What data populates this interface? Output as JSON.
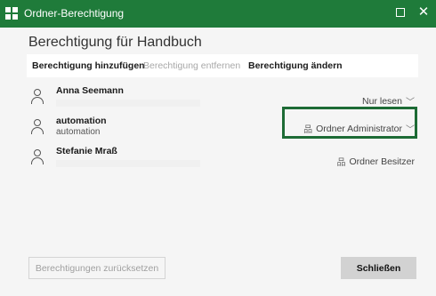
{
  "window": {
    "title": "Ordner-Berechtigung",
    "maximize_icon": "maximize-icon",
    "close_symbol": "✕"
  },
  "page_title": "Berechtigung für Handbuch",
  "actions": [
    {
      "label": "Berechtigung hinzufügen",
      "enabled": true
    },
    {
      "label": "Berechtigung entfernen",
      "enabled": false
    },
    {
      "label": "Berechtigung ändern",
      "enabled": true
    }
  ],
  "users": [
    {
      "name": "Anna Seemann",
      "subtitle": "",
      "permission": "Nur lesen",
      "perm_icon": "",
      "has_dropdown": true
    },
    {
      "name": "automation",
      "subtitle": "automation",
      "permission": "Ordner Administrator",
      "perm_icon": "品",
      "has_dropdown": true
    },
    {
      "name": "Stefanie Mraß",
      "subtitle": "",
      "permission": "Ordner Besitzer",
      "perm_icon": "品",
      "has_dropdown": false
    }
  ],
  "footer": {
    "reset_label": "Berechtigungen zurücksetzen",
    "close_label": "Schließen"
  },
  "colors": {
    "titlebar": "#1f7b3a",
    "highlight": "#1d6b35"
  }
}
